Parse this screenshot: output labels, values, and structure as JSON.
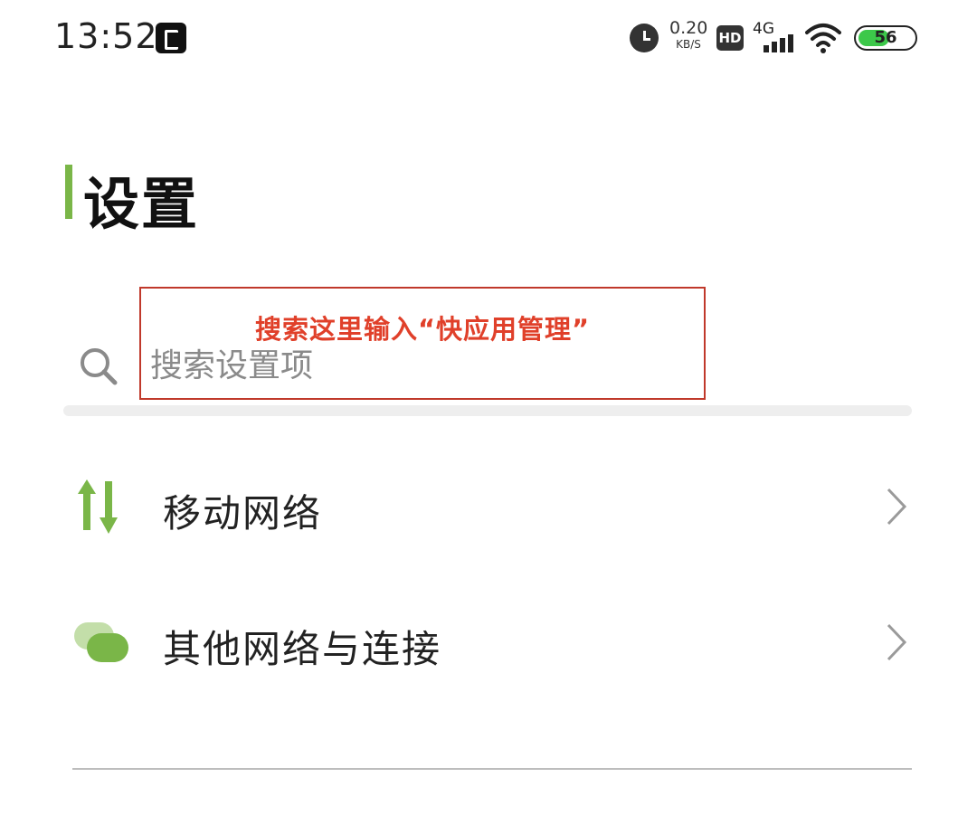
{
  "status_bar": {
    "time": "13:52",
    "net_speed_value": "0.20",
    "net_speed_unit": "KB/S",
    "hd_label": "HD",
    "signal_label": "4G",
    "battery_level": "56",
    "battery_fill_percent": 56,
    "battery_color": "#3cc84a"
  },
  "header": {
    "title": "设置",
    "accent_color": "#7ab648"
  },
  "search": {
    "placeholder": "搜索设置项",
    "icon": "search-icon"
  },
  "annotation": {
    "text": "搜索这里输入“快应用管理”",
    "color": "#e0402a"
  },
  "settings": {
    "items": [
      {
        "label": "移动网络",
        "icon": "mobile-data-icon"
      },
      {
        "label": "其他网络与连接",
        "icon": "other-connections-icon"
      }
    ]
  }
}
